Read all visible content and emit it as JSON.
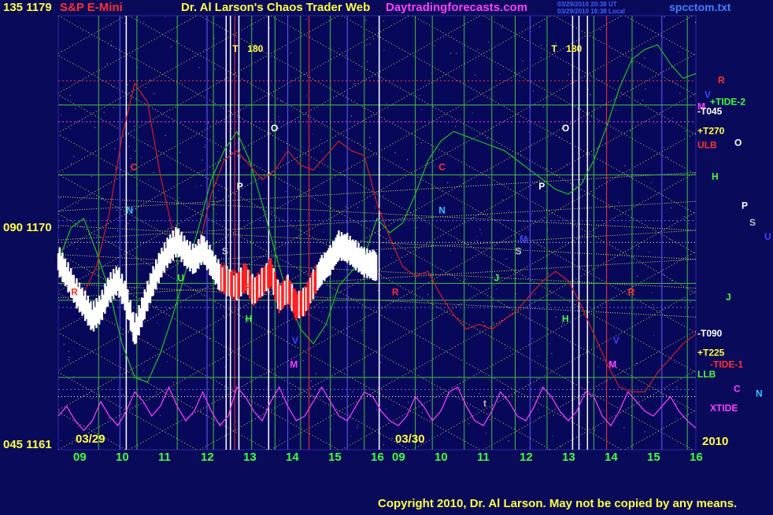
{
  "header": {
    "top_left": "135 1179",
    "instrument": "S&P E-Mini",
    "title": "Dr. Al Larson's Chaos Trader Web",
    "site": "Daytradingforecasts.com",
    "stamp1": "03/29/2010 20:38 UT",
    "stamp2": "03/29/2010 16:38 Local",
    "file": "spcctom.txt"
  },
  "scale": {
    "mid": "090 1170",
    "bottom": "045 1161"
  },
  "footer": {
    "copyright": "Copyright 2010, Dr. Al Larson. May not be copied by any means.",
    "year": "2010",
    "day1": "03/29",
    "day2": "03/30"
  },
  "colors": {
    "background": "#0a0a5a",
    "plot_bg": "#08085a",
    "price_up": "#ffffff",
    "price_down": "#ff2020",
    "xtide": "#ff40ff",
    "flux_green": "#20c020",
    "flux_red": "#d02020",
    "grid_green": "#40c040",
    "grid_yellow": "#e0e060",
    "grid_blue": "#6060ff",
    "grid_white": "#ffffff"
  },
  "chart_data": {
    "type": "line",
    "ylim": [
      1161,
      1179
    ],
    "hour_labels": [
      "09",
      "10",
      "11",
      "12",
      "13",
      "14",
      "15",
      "16",
      "09",
      "10",
      "11",
      "12",
      "13",
      "14",
      "15",
      "16"
    ],
    "session_hours": [
      8.5,
      16
    ],
    "price": {
      "name": "",
      "hours": [
        8.5,
        8.7,
        8.9,
        9.1,
        9.3,
        9.5,
        9.7,
        9.9,
        10.1,
        10.3,
        10.5,
        10.7,
        10.9,
        11.1,
        11.3,
        11.5,
        11.7,
        11.9,
        12.1,
        12.3,
        12.5,
        12.7,
        12.9,
        13.1,
        13.3,
        13.5,
        13.7,
        13.9,
        14.1,
        14.3,
        14.5,
        14.7,
        14.9,
        15.1,
        15.3,
        15.5,
        15.7,
        15.9,
        16.0
      ],
      "values": [
        1168.8,
        1168.2,
        1167.5,
        1167.0,
        1166.4,
        1166.8,
        1167.6,
        1168.0,
        1167.2,
        1165.8,
        1166.8,
        1167.8,
        1168.6,
        1169.2,
        1169.6,
        1169.1,
        1168.8,
        1169.3,
        1168.7,
        1168.1,
        1167.9,
        1167.7,
        1168.1,
        1167.5,
        1167.9,
        1168.3,
        1167.2,
        1167.6,
        1166.9,
        1167.1,
        1167.8,
        1168.4,
        1168.8,
        1169.4,
        1169.3,
        1169.0,
        1168.7,
        1168.6,
        1168.5
      ]
    },
    "flux_green_day1": {
      "hours": [
        8.5,
        8.8,
        9.1,
        9.4,
        9.7,
        10.0,
        10.3,
        10.6,
        10.9,
        11.2,
        11.5,
        11.8,
        12.1,
        12.4,
        12.7,
        13.0,
        13.3,
        13.6,
        13.9,
        14.2,
        14.5,
        14.8,
        15.1,
        15.4,
        15.7,
        16.0
      ],
      "values": [
        1168.8,
        1170.2,
        1170.6,
        1169.2,
        1167.6,
        1165.4,
        1164.0,
        1163.8,
        1165.0,
        1166.6,
        1168.4,
        1170.2,
        1172.2,
        1173.4,
        1174.2,
        1173.0,
        1171.2,
        1169.2,
        1167.4,
        1166.0,
        1165.4,
        1166.2,
        1167.8,
        1168.4,
        1169.0,
        1170.6
      ]
    },
    "flux_red_day1": {
      "hours": [
        8.5,
        8.8,
        9.1,
        9.4,
        9.7,
        10.0,
        10.3,
        10.6,
        10.9,
        11.2,
        11.5,
        11.8,
        12.1,
        12.4,
        12.7,
        13.0,
        13.3,
        13.6,
        13.9,
        14.2,
        14.5,
        14.8,
        15.1,
        15.4,
        15.7,
        16.0
      ],
      "values": [
        1168.8,
        1168.0,
        1167.5,
        1168.6,
        1170.8,
        1174.0,
        1176.2,
        1175.4,
        1172.4,
        1170.0,
        1168.8,
        1169.4,
        1171.6,
        1173.0,
        1173.4,
        1172.8,
        1172.2,
        1172.6,
        1173.4,
        1172.8,
        1172.6,
        1173.2,
        1173.8,
        1173.4,
        1173.2,
        1171.2
      ]
    },
    "flux_green_day2": {
      "hours": [
        8.5,
        8.8,
        9.1,
        9.4,
        9.7,
        10.0,
        10.3,
        10.6,
        10.9,
        11.2,
        11.5,
        11.8,
        12.1,
        12.4,
        12.7,
        13.0,
        13.3,
        13.6,
        13.9,
        14.2,
        14.5,
        14.8,
        15.1,
        15.4,
        15.7,
        16.0
      ],
      "values": [
        1170.6,
        1170.0,
        1170.4,
        1171.6,
        1173.0,
        1173.8,
        1174.2,
        1174.0,
        1173.8,
        1173.6,
        1173.4,
        1173.0,
        1172.6,
        1172.2,
        1171.8,
        1171.6,
        1172.0,
        1173.0,
        1174.4,
        1176.0,
        1177.2,
        1177.6,
        1177.8,
        1177.0,
        1176.4,
        1176.6
      ]
    },
    "flux_red_day2": {
      "hours": [
        8.5,
        8.8,
        9.1,
        9.4,
        9.7,
        10.0,
        10.3,
        10.6,
        10.9,
        11.2,
        11.5,
        11.8,
        12.1,
        12.4,
        12.7,
        13.0,
        13.3,
        13.6,
        13.9,
        14.2,
        14.5,
        14.8,
        15.1,
        15.4,
        15.7,
        16.0
      ],
      "values": [
        1171.2,
        1169.8,
        1168.6,
        1168.2,
        1168.4,
        1167.4,
        1166.6,
        1166.0,
        1166.2,
        1166.0,
        1166.4,
        1166.8,
        1167.4,
        1168.0,
        1168.4,
        1168.0,
        1167.0,
        1165.8,
        1164.6,
        1163.6,
        1163.4,
        1163.4,
        1164.2,
        1164.8,
        1165.4,
        1165.8
      ]
    },
    "xtide": {
      "hours": [
        8.5,
        8.7,
        8.9,
        9.1,
        9.3,
        9.5,
        9.7,
        9.9,
        10.1,
        10.3,
        10.5,
        10.7,
        10.9,
        11.1,
        11.3,
        11.5,
        11.7,
        11.9,
        12.1,
        12.3,
        12.5,
        12.7,
        12.9,
        13.1,
        13.3,
        13.5,
        13.7,
        13.9,
        14.1,
        14.3,
        14.5,
        14.7,
        14.9,
        15.1,
        15.3,
        15.5,
        15.7,
        15.9,
        16.1,
        16.3,
        16.5,
        16.7,
        16.9,
        17.1,
        17.3,
        17.5,
        17.7,
        17.9,
        18.1,
        18.3,
        18.5,
        18.7,
        18.9,
        19.1,
        19.3,
        19.5,
        19.7,
        19.9,
        20.1,
        20.3,
        20.5,
        20.7,
        20.9,
        21.1,
        21.3,
        21.5,
        21.7,
        21.9,
        22.1,
        22.3,
        22.5,
        22.7,
        22.9,
        23.1,
        23.3,
        23.5
      ],
      "values": [
        1162.4,
        1162.8,
        1162.2,
        1161.8,
        1162.2,
        1163.0,
        1162.4,
        1162.0,
        1162.6,
        1163.4,
        1163.0,
        1162.4,
        1162.8,
        1163.6,
        1162.8,
        1162.2,
        1162.6,
        1163.4,
        1162.6,
        1162.0,
        1162.4,
        1163.6,
        1163.2,
        1162.6,
        1162.2,
        1163.0,
        1163.6,
        1162.8,
        1162.2,
        1162.4,
        1163.0,
        1163.6,
        1163.0,
        1162.4,
        1162.2,
        1162.8,
        1163.4,
        1163.2,
        1162.6,
        1162.2,
        1162.0,
        1162.4,
        1163.2,
        1162.8,
        1162.2,
        1162.6,
        1163.4,
        1163.6,
        1162.8,
        1162.2,
        1162.0,
        1162.6,
        1163.4,
        1163.0,
        1162.4,
        1162.2,
        1162.8,
        1163.6,
        1163.2,
        1162.6,
        1162.2,
        1162.6,
        1163.4,
        1163.2,
        1162.4,
        1162.0,
        1162.6,
        1163.4,
        1163.0,
        1162.6,
        1162.4,
        1162.8,
        1163.2,
        1162.6,
        1162.2,
        1161.9
      ]
    },
    "day1_labels": [
      {
        "t": "T",
        "c": "#ffff40",
        "h": 12.6,
        "v": 1177.5
      },
      {
        "t": "180",
        "c": "#ffff40",
        "h": 12.95,
        "v": 1177.5
      },
      {
        "t": "O",
        "c": "#ffffff",
        "h": 13.5,
        "v": 1174.2
      },
      {
        "t": "C",
        "c": "#ff3030",
        "h": 10.2,
        "v": 1172.6
      },
      {
        "t": "P",
        "c": "#ffffff",
        "h": 12.7,
        "v": 1171.8
      },
      {
        "t": "N",
        "c": "#40c0ff",
        "h": 10.1,
        "v": 1170.8
      },
      {
        "t": "S",
        "c": "#c0c0c0",
        "h": 12.35,
        "v": 1169.1
      },
      {
        "t": "U",
        "c": "#40ff40",
        "h": 11.3,
        "v": 1168.0
      },
      {
        "t": "H",
        "c": "#40ff40",
        "h": 12.9,
        "v": 1166.3
      },
      {
        "t": "V",
        "c": "#4040ff",
        "h": 14.0,
        "v": 1165.4
      },
      {
        "t": "M",
        "c": "#ff40ff",
        "h": 13.95,
        "v": 1164.4
      },
      {
        "t": "R",
        "c": "#ff3030",
        "h": 8.8,
        "v": 1167.4
      },
      {
        "t": "R",
        "c": "#ff3030",
        "h": 12.9,
        "v": 1167.6
      }
    ],
    "day2_labels": [
      {
        "t": "T",
        "c": "#ffff40",
        "h": 12.6,
        "v": 1177.5
      },
      {
        "t": "180",
        "c": "#ffff40",
        "h": 12.95,
        "v": 1177.5
      },
      {
        "t": "O",
        "c": "#ffffff",
        "h": 12.85,
        "v": 1174.2
      },
      {
        "t": "C",
        "c": "#ff3030",
        "h": 9.95,
        "v": 1172.6
      },
      {
        "t": "P",
        "c": "#ffffff",
        "h": 12.3,
        "v": 1171.8
      },
      {
        "t": "N",
        "c": "#40c0ff",
        "h": 9.95,
        "v": 1170.8
      },
      {
        "t": "S",
        "c": "#c0c0c0",
        "h": 11.75,
        "v": 1169.1
      },
      {
        "t": "J",
        "c": "#40ff40",
        "h": 11.25,
        "v": 1168.0
      },
      {
        "t": "H",
        "c": "#40ff40",
        "h": 12.85,
        "v": 1166.3
      },
      {
        "t": "V",
        "c": "#4040ff",
        "h": 14.05,
        "v": 1165.4
      },
      {
        "t": "M",
        "c": "#ff40ff",
        "h": 13.95,
        "v": 1164.4
      },
      {
        "t": "R",
        "c": "#ff3030",
        "h": 8.85,
        "v": 1167.4
      },
      {
        "t": "R",
        "c": "#ff3030",
        "h": 14.4,
        "v": 1167.4
      },
      {
        "t": "M",
        "c": "#4040ff",
        "h": 11.85,
        "v": 1169.6
      },
      {
        "t": "t",
        "c": "#c0c0c0",
        "h": 11.0,
        "v": 1162.8
      }
    ],
    "right_legend": [
      {
        "t": "R",
        "c": "#ff3030",
        "v": 1176.2
      },
      {
        "t": "V",
        "c": "#4040ff",
        "v": 1175.6
      },
      {
        "t": "M",
        "c": "#ff40ff",
        "v": 1175.1
      },
      {
        "t": "+TIDE-2",
        "c": "#40ff40",
        "v": 1175.3
      },
      {
        "t": "-T045",
        "c": "#ffffff",
        "v": 1174.9
      },
      {
        "t": "+T270",
        "c": "#ffff40",
        "v": 1174.1
      },
      {
        "t": "ULB",
        "c": "#ff3030",
        "v": 1173.5
      },
      {
        "t": "O",
        "c": "#ffffff",
        "v": 1173.6
      },
      {
        "t": "H",
        "c": "#40ff40",
        "v": 1172.2
      },
      {
        "t": "P",
        "c": "#ffffff",
        "v": 1171.0
      },
      {
        "t": "S",
        "c": "#c0c0c0",
        "v": 1170.3
      },
      {
        "t": "U",
        "c": "#4040ff",
        "v": 1169.7
      },
      {
        "t": "J",
        "c": "#40ff40",
        "v": 1167.2
      },
      {
        "t": "-T090",
        "c": "#ffffff",
        "v": 1165.7
      },
      {
        "t": "+T225",
        "c": "#ffff40",
        "v": 1164.9
      },
      {
        "t": "-TIDE-1",
        "c": "#ff3030",
        "v": 1164.4
      },
      {
        "t": "LLB",
        "c": "#40ff40",
        "v": 1164.0
      },
      {
        "t": "C",
        "c": "#ff40ff",
        "v": 1163.4
      },
      {
        "t": "N",
        "c": "#40c0ff",
        "v": 1163.2
      },
      {
        "t": "XTIDE",
        "c": "#ff40ff",
        "v": 1162.6
      }
    ],
    "h_lines": [
      {
        "v": 1176.3,
        "c": "#ff3030",
        "dash": "2,3"
      },
      {
        "v": 1175.3,
        "c": "#40c040",
        "dash": ""
      },
      {
        "v": 1174.6,
        "c": "#ff40ff",
        "dash": "2,3"
      },
      {
        "v": 1172.4,
        "c": "#40c040",
        "dash": ""
      },
      {
        "v": 1170.5,
        "c": "#6060ff",
        "dash": "2,3"
      },
      {
        "v": 1169.6,
        "c": "#ffffff",
        "dash": "1,3"
      },
      {
        "v": 1167.9,
        "c": "#40c040",
        "dash": ""
      },
      {
        "v": 1167.2,
        "c": "#40c040",
        "dash": ""
      },
      {
        "v": 1166.9,
        "c": "#6060ff",
        "dash": "2,3"
      },
      {
        "v": 1164.0,
        "c": "#40c040",
        "dash": ""
      },
      {
        "v": 1163.5,
        "c": "#6060ff",
        "dash": "2,3"
      },
      {
        "v": 1163.2,
        "c": "#ffffff",
        "dash": "1,3"
      }
    ],
    "v_lines": [
      {
        "h": 9.45,
        "c": "#40c040"
      },
      {
        "h": 9.95,
        "c": "#6060ff"
      },
      {
        "h": 10.1,
        "c": "#ffffff"
      },
      {
        "h": 10.35,
        "c": "#40c040"
      },
      {
        "h": 11.3,
        "c": "#40c040"
      },
      {
        "h": 12.0,
        "c": "#6060ff"
      },
      {
        "h": 12.15,
        "c": "#40c040"
      },
      {
        "h": 12.45,
        "c": "#ffffff"
      },
      {
        "h": 12.55,
        "c": "#ffffff"
      },
      {
        "h": 12.65,
        "c": "#ff3030"
      },
      {
        "h": 12.75,
        "c": "#ffffff"
      },
      {
        "h": 13.05,
        "c": "#40c040"
      },
      {
        "h": 13.45,
        "c": "#ffffff"
      },
      {
        "h": 13.6,
        "c": "#40c040"
      },
      {
        "h": 13.9,
        "c": "#6060ff"
      },
      {
        "h": 14.2,
        "c": "#40c040"
      },
      {
        "h": 14.4,
        "c": "#ff3030"
      },
      {
        "h": 14.9,
        "c": "#40c040"
      },
      {
        "h": 15.3,
        "c": "#6060ff"
      },
      {
        "h": 15.7,
        "c": "#40c040"
      },
      {
        "h": 16.05,
        "c": "#ffffff"
      },
      {
        "h": 16.9,
        "c": "#40c040"
      },
      {
        "h": 17.3,
        "c": "#40c040"
      },
      {
        "h": 18.05,
        "c": "#40c040"
      },
      {
        "h": 18.7,
        "c": "#40c040"
      },
      {
        "h": 19.25,
        "c": "#40c040"
      },
      {
        "h": 19.6,
        "c": "#6060ff"
      },
      {
        "h": 20.0,
        "c": "#40c040"
      },
      {
        "h": 20.6,
        "c": "#ffffff"
      },
      {
        "h": 20.75,
        "c": "#ffffff"
      },
      {
        "h": 20.95,
        "c": "#ffffff"
      },
      {
        "h": 21.1,
        "c": "#40c040"
      },
      {
        "h": 21.4,
        "c": "#ff3030"
      },
      {
        "h": 22.0,
        "c": "#40c040"
      },
      {
        "h": 22.7,
        "c": "#6060ff"
      },
      {
        "h": 23.3,
        "c": "#40c040"
      }
    ]
  }
}
